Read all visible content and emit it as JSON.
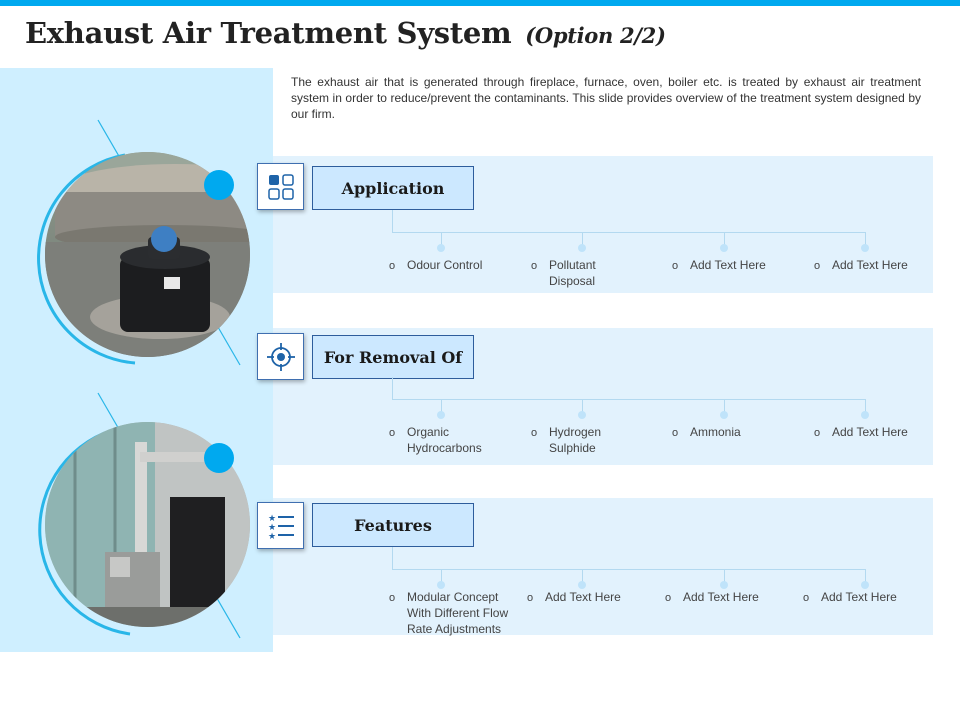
{
  "title": {
    "main": "Exhaust Air Treatment System",
    "sub": "(Option 2/2)"
  },
  "intro": "The exhaust air that is generated through fireplace, furnace, oven, boiler etc. is treated by exhaust air treatment system in order to reduce/prevent the contaminants. This slide provides overview of the treatment system designed by our firm.",
  "sections": [
    {
      "heading": "Application",
      "icon": "grid-squares-icon",
      "items": [
        "Odour Control",
        "Pollutant Disposal",
        "Add Text Here",
        "Add Text Here"
      ]
    },
    {
      "heading": "For Removal Of",
      "icon": "target-crosshair-icon",
      "items": [
        "Organic Hydrocarbons",
        "Hydrogen Sulphide",
        "Ammonia",
        "Add Text Here"
      ]
    },
    {
      "heading": "Features",
      "icon": "star-list-icon",
      "items": [
        "Modular Concept With Different Flow Rate Adjustments",
        "Add Text Here",
        "Add Text Here",
        "Add Text Here"
      ]
    }
  ],
  "colors": {
    "accent": "#00a9ef",
    "panel": "#cfefff",
    "band": "#e2f2fd",
    "heading_box": "#cce8ff",
    "border": "#2e5d9c"
  }
}
